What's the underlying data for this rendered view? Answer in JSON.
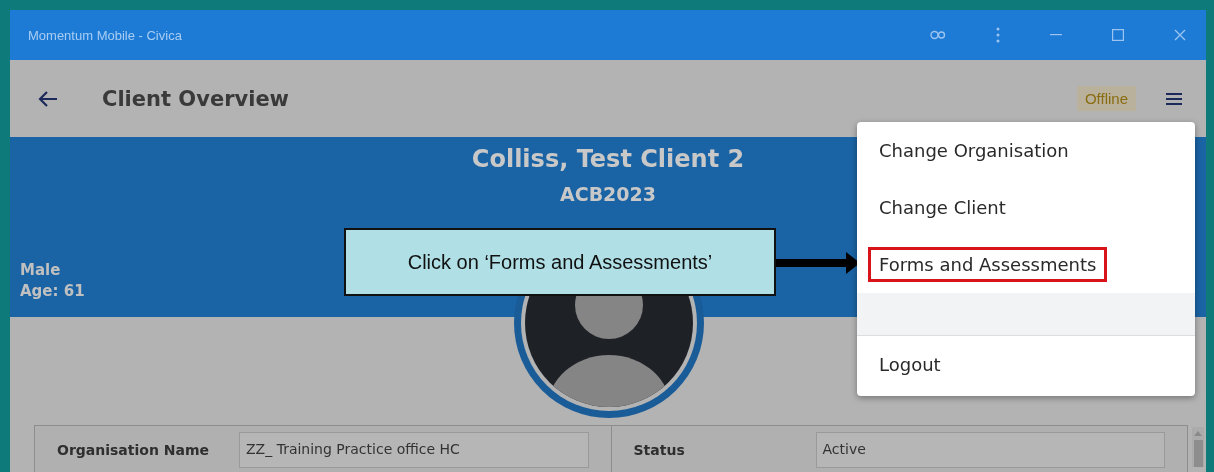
{
  "window": {
    "title": "Momentum Mobile - Civica"
  },
  "header": {
    "title": "Client Overview",
    "status": "Offline"
  },
  "client": {
    "name": "Colliss, Test Client 2",
    "id": "ACB2023",
    "gender": "Male",
    "age": "Age: 61"
  },
  "menu": [
    {
      "kind": "option",
      "label": "Change Organisation",
      "highlighted": false,
      "hovered": false
    },
    {
      "kind": "option",
      "label": "Change Client",
      "highlighted": false,
      "hovered": false
    },
    {
      "kind": "option",
      "label": "Forms and Assessments",
      "highlighted": true,
      "hovered": false
    },
    {
      "kind": "blank",
      "hovered": true
    },
    {
      "kind": "option",
      "label": "Logout",
      "highlighted": false,
      "hovered": false,
      "divider_above": true
    }
  ],
  "callout": {
    "text": "Click on ‘Forms and Assessments’"
  },
  "fields": [
    {
      "label": "Organisation Name",
      "value": "ZZ_ Training Practice office HC"
    },
    {
      "label": "Status",
      "value": "Active"
    }
  ]
}
